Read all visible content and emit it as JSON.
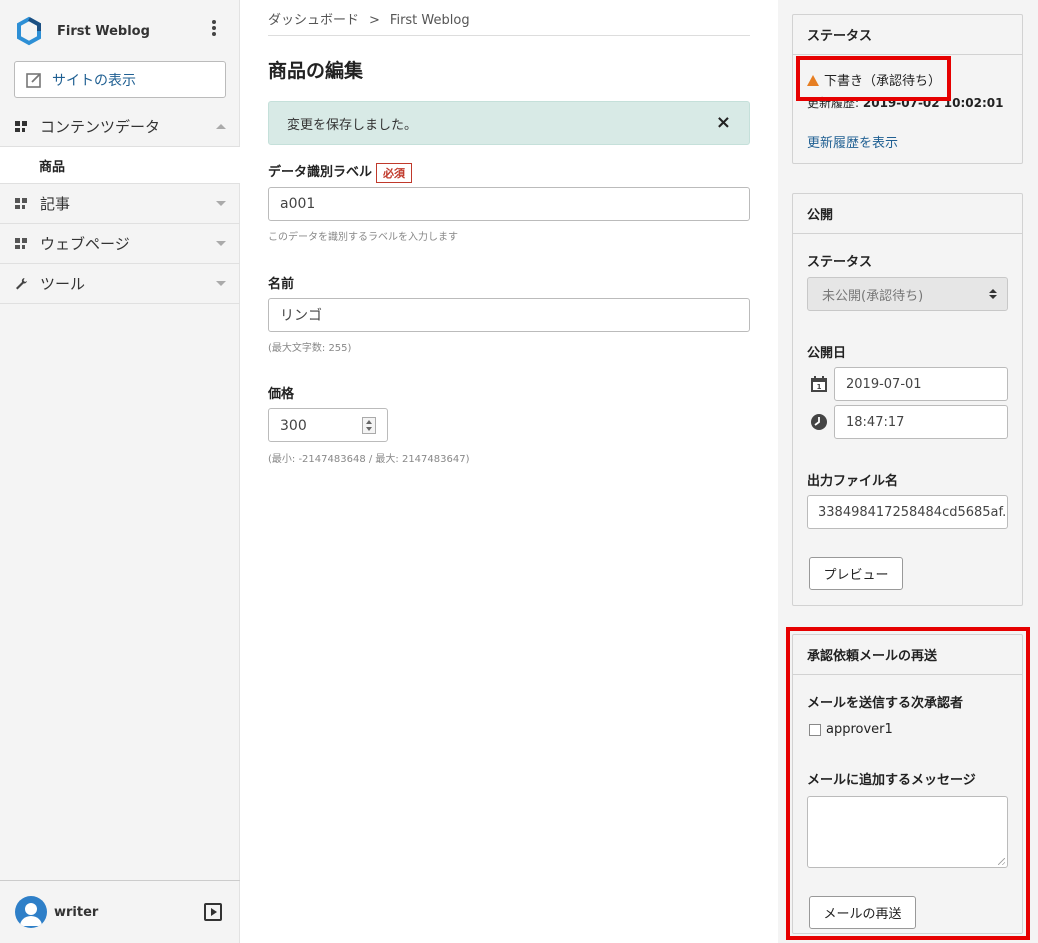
{
  "colors": {
    "link": "#1f5f92",
    "alert_bg": "#d8eae6",
    "required_red": "#c0392b",
    "highlight_red": "#e60000",
    "warning_orange": "#e67e22"
  },
  "sidebar": {
    "brand": "First Weblog",
    "site_view_button": "サイトの表示",
    "nav": [
      {
        "label": "コンテンツデータ",
        "icon": "content-data-icon",
        "expanded": true
      },
      {
        "label": "商品",
        "sub": true
      },
      {
        "label": "記事",
        "icon": "entry-icon",
        "expanded": false
      },
      {
        "label": "ウェブページ",
        "icon": "webpage-icon",
        "expanded": false
      },
      {
        "label": "ツール",
        "icon": "wrench-icon",
        "expanded": false
      }
    ],
    "user": "writer"
  },
  "main": {
    "breadcrumb": [
      "ダッシュボード",
      ">",
      "First Weblog"
    ],
    "title": "商品の編集",
    "alert": "変更を保存しました。",
    "alert_close": "×",
    "fields": {
      "label_field": {
        "label": "データ識別ラベル",
        "required": "必須",
        "value": "a001",
        "hint": "このデータを識別するラベルを入力します"
      },
      "name_field": {
        "label": "名前",
        "value": "リンゴ",
        "hint": "(最大文字数: 255)"
      },
      "price_field": {
        "label": "価格",
        "value": "300",
        "hint": "(最小: -2147483648 / 最大: 2147483647)"
      }
    }
  },
  "right": {
    "status_panel": {
      "title": "ステータス",
      "status": "下書き（承認待ち）",
      "history_label": "更新履歴:",
      "history_value": "2019-07-02 10:02:01",
      "history_link": "更新履歴を表示"
    },
    "publish_panel": {
      "title": "公開",
      "status_label": "ステータス",
      "status_value": "未公開(承認待ち)",
      "date_label": "公開日",
      "date": "2019-07-01",
      "time": "18:47:17",
      "file_label": "出力ファイル名",
      "file": "338498417258484cd5685af.",
      "preview": "プレビュー"
    },
    "resend_panel": {
      "title": "承認依頼メールの再送",
      "approver_label": "メールを送信する次承認者",
      "approver": "approver1",
      "message_label": "メールに追加するメッセージ",
      "message": "",
      "button": "メールの再送"
    }
  }
}
